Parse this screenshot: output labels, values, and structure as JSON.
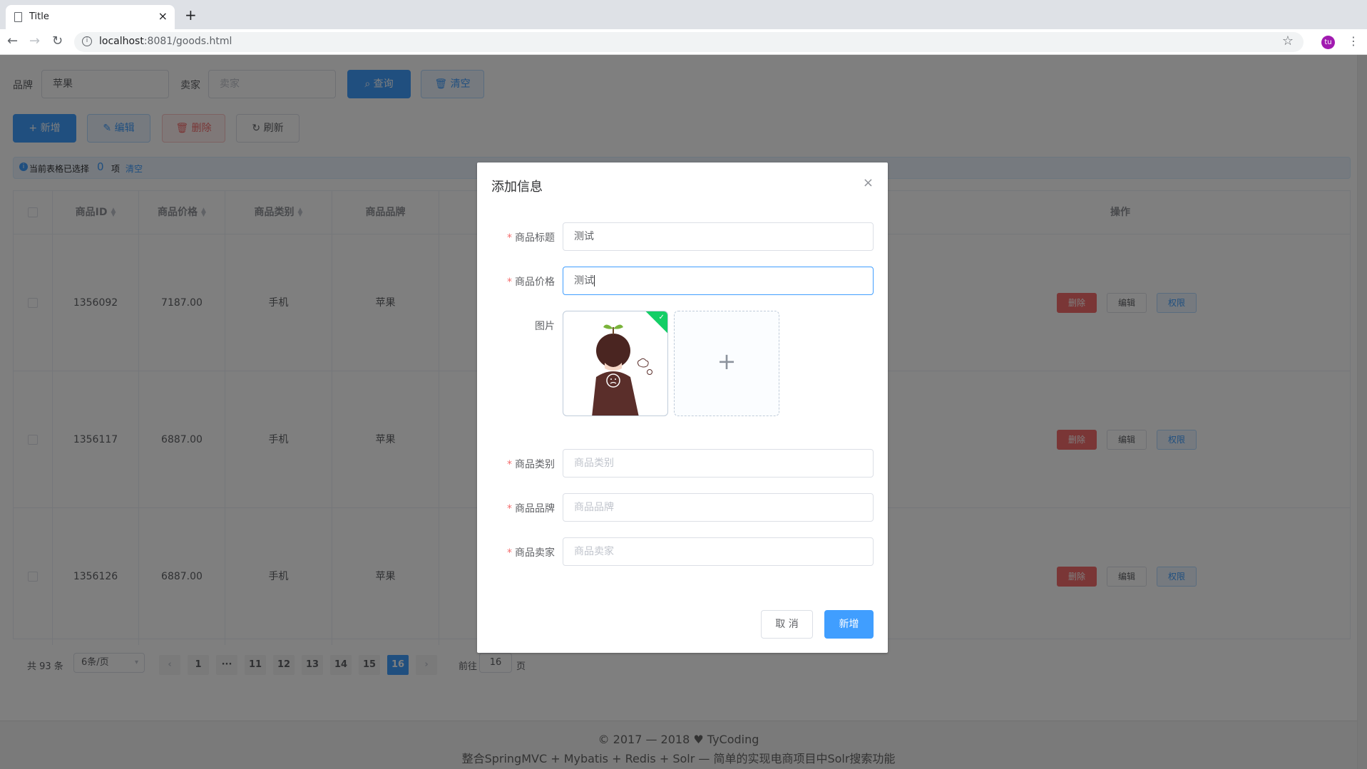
{
  "browser": {
    "tab_title": "Title",
    "tab_close": "×",
    "new_tab": "+",
    "url_host": "localhost",
    "url_rest": ":8081/goods.html",
    "avatar_initials": "tu"
  },
  "search": {
    "brand_label": "品牌",
    "brand_value": "苹果",
    "seller_label": "卖家",
    "seller_placeholder": "卖家",
    "query_label": "查询",
    "clear_label": "清空"
  },
  "toolbar": {
    "add_label": "新增",
    "edit_label": "编辑",
    "delete_label": "删除",
    "refresh_label": "刷新"
  },
  "selection_alert": {
    "prefix": "当前表格已选择",
    "count": "0",
    "suffix": "项",
    "clear_link": "清空"
  },
  "table": {
    "headers": {
      "id": "商品ID",
      "price": "商品价格",
      "category": "商品类别",
      "brand": "商品品牌",
      "partial": "商",
      "actions": "操作"
    },
    "rows": [
      {
        "id": "1356092",
        "price": "7187.00",
        "category": "手机",
        "brand": "苹果"
      },
      {
        "id": "1356117",
        "price": "6887.00",
        "category": "手机",
        "brand": "苹果"
      },
      {
        "id": "1356126",
        "price": "6887.00",
        "category": "手机",
        "brand": "苹果"
      }
    ],
    "row_actions": {
      "delete": "删除",
      "edit": "编辑",
      "perm": "权限"
    }
  },
  "pagination": {
    "total_text": "共 93 条",
    "page_size": "6条/页",
    "pages": [
      "1",
      "···",
      "11",
      "12",
      "13",
      "14",
      "15",
      "16"
    ],
    "current_page": "16",
    "goto_prefix": "前往",
    "goto_value": "16",
    "goto_suffix": "页"
  },
  "footer": {
    "line1": "© 2017 — 2018 ♥ TyCoding",
    "line2": "整合SpringMVC + Mybatis + Redis + Solr — 简单的实现电商项目中Solr搜索功能"
  },
  "dialog": {
    "title": "添加信息",
    "close": "×",
    "fields": {
      "title_label": "商品标题",
      "title_value": "测试",
      "price_label": "商品价格",
      "price_value": "测试",
      "image_label": "图片",
      "category_label": "商品类别",
      "category_placeholder": "商品类别",
      "brand_label": "商品品牌",
      "brand_placeholder": "商品品牌",
      "seller_label": "商品卖家",
      "seller_placeholder": "商品卖家"
    },
    "cancel_label": "取 消",
    "submit_label": "新增"
  },
  "colors": {
    "primary": "#409eff",
    "danger": "#f56c6c",
    "success": "#13ce66",
    "required": "#f56c6c"
  }
}
